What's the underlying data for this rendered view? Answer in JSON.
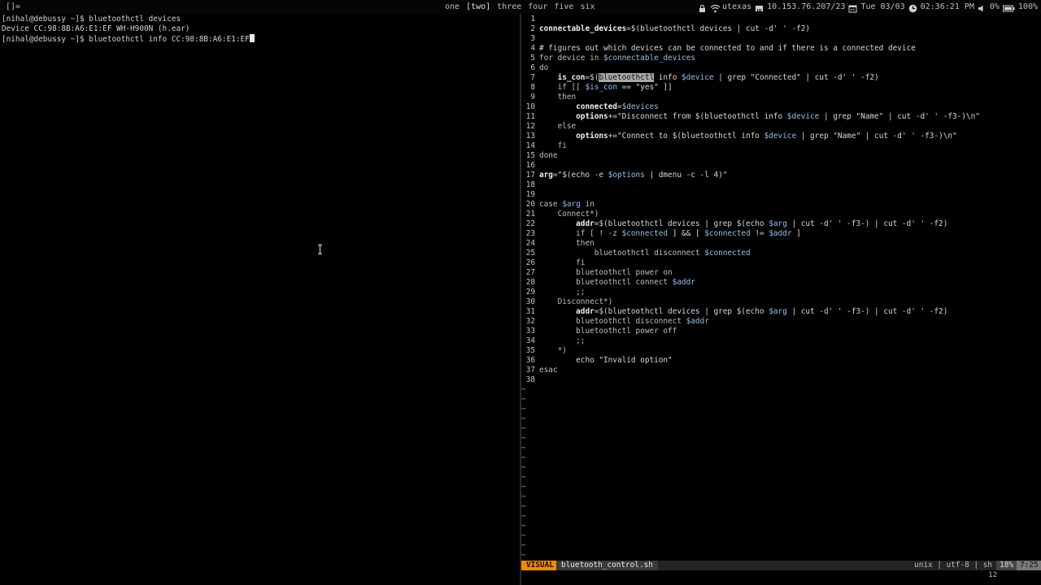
{
  "topbar": {
    "layout": "[]=",
    "workspaces": [
      {
        "label": "one",
        "active": false
      },
      {
        "label": "[two]",
        "active": true
      },
      {
        "label": "three",
        "active": false
      },
      {
        "label": "four",
        "active": false
      },
      {
        "label": "five",
        "active": false
      },
      {
        "label": "six",
        "active": false
      }
    ],
    "network_name": "utexas",
    "ip": "10.153.76.207/23",
    "date": "Tue 03/03",
    "time": "02:36:21 PM",
    "volume": "0%",
    "battery": "100%"
  },
  "terminal": {
    "lines": [
      "[nihal@debussy ~]$ bluetoothctl devices",
      "Device CC:98:8B:A6:E1:EF WH-H900N (h.ear)",
      "[nihal@debussy ~]$ bluetoothctl info CC:98:8B:A6:E1:EF"
    ]
  },
  "editor": {
    "lines": [
      {
        "n": "1",
        "segs": []
      },
      {
        "n": "2",
        "segs": [
          [
            "bold",
            "connectable_devices"
          ],
          [
            "",
            "=$(bluetoothctl devices | cut -d' ' -f2)"
          ]
        ]
      },
      {
        "n": "3",
        "segs": []
      },
      {
        "n": "4",
        "segs": [
          [
            "cmt",
            "# figures out which devices can be connected to and if there is a connected device"
          ]
        ]
      },
      {
        "n": "5",
        "segs": [
          [
            "kw",
            "for device in "
          ],
          [
            "var",
            "$connectable_devices"
          ]
        ]
      },
      {
        "n": "6",
        "segs": [
          [
            "kw",
            "do"
          ]
        ]
      },
      {
        "n": "7",
        "segs": [
          [
            "",
            "    "
          ],
          [
            "bold",
            "is_con"
          ],
          [
            "",
            "=$("
          ],
          [
            "sel",
            "bluetoothctl"
          ],
          [
            "",
            " info "
          ],
          [
            "var",
            "$device"
          ],
          [
            "",
            " | grep \"Connected\" | cut -d' ' -f2)"
          ]
        ]
      },
      {
        "n": "8",
        "segs": [
          [
            "",
            "    "
          ],
          [
            "kw",
            "if [[ "
          ],
          [
            "var",
            "$is_con"
          ],
          [
            "",
            " == \"yes\" ]]"
          ]
        ]
      },
      {
        "n": "9",
        "segs": [
          [
            "",
            "    "
          ],
          [
            "kw",
            "then"
          ]
        ]
      },
      {
        "n": "10",
        "segs": [
          [
            "",
            "        "
          ],
          [
            "bold",
            "connected"
          ],
          [
            "",
            "="
          ],
          [
            "var",
            "$devices"
          ]
        ]
      },
      {
        "n": "11",
        "segs": [
          [
            "",
            "        "
          ],
          [
            "bold",
            "options"
          ],
          [
            "",
            "+=\"Disconnect from $(bluetoothctl info "
          ],
          [
            "var",
            "$device"
          ],
          [
            "",
            " | grep \"Name\" | cut -d' ' -f3-)\\n\""
          ]
        ]
      },
      {
        "n": "12",
        "segs": [
          [
            "",
            "    "
          ],
          [
            "kw",
            "else"
          ]
        ]
      },
      {
        "n": "13",
        "segs": [
          [
            "",
            "        "
          ],
          [
            "bold",
            "options"
          ],
          [
            "",
            "+=\"Connect to $(bluetoothctl info "
          ],
          [
            "var",
            "$device"
          ],
          [
            "",
            " | grep \"Name\" | cut -d' ' -f3-)\\n\""
          ]
        ]
      },
      {
        "n": "14",
        "segs": [
          [
            "",
            "    "
          ],
          [
            "kw",
            "fi"
          ]
        ]
      },
      {
        "n": "15",
        "segs": [
          [
            "kw",
            "done"
          ]
        ]
      },
      {
        "n": "16",
        "segs": []
      },
      {
        "n": "17",
        "segs": [
          [
            "bold",
            "arg"
          ],
          [
            "",
            "=\"$(echo -e "
          ],
          [
            "var",
            "$options"
          ],
          [
            "",
            " | dmenu -c -l 4)\""
          ]
        ]
      },
      {
        "n": "18",
        "segs": []
      },
      {
        "n": "19",
        "segs": []
      },
      {
        "n": "20",
        "segs": [
          [
            "kw",
            "case "
          ],
          [
            "var",
            "$arg"
          ],
          [
            "kw",
            " in"
          ]
        ]
      },
      {
        "n": "21",
        "segs": [
          [
            "",
            "    "
          ],
          [
            "kw",
            "Connect*)"
          ]
        ]
      },
      {
        "n": "22",
        "segs": [
          [
            "",
            "        "
          ],
          [
            "bold",
            "addr"
          ],
          [
            "",
            "=$(bluetoothctl devices | grep $(echo "
          ],
          [
            "var",
            "$arg"
          ],
          [
            "",
            " | cut -d' ' -f3-) | cut -d' ' -f2)"
          ]
        ]
      },
      {
        "n": "23",
        "segs": [
          [
            "",
            "        "
          ],
          [
            "kw",
            "if [ ! -z "
          ],
          [
            "var",
            "$connected"
          ],
          [
            "",
            " ] && [ "
          ],
          [
            "var",
            "$connected"
          ],
          [
            "",
            " != "
          ],
          [
            "var",
            "$addr"
          ],
          [
            "",
            " ]"
          ]
        ]
      },
      {
        "n": "24",
        "segs": [
          [
            "",
            "        "
          ],
          [
            "kw",
            "then"
          ]
        ]
      },
      {
        "n": "25",
        "segs": [
          [
            "",
            "            "
          ],
          [
            "kw",
            "bluetoothctl disconnect "
          ],
          [
            "var",
            "$connected"
          ]
        ]
      },
      {
        "n": "26",
        "segs": [
          [
            "",
            "        "
          ],
          [
            "kw",
            "fi"
          ]
        ]
      },
      {
        "n": "27",
        "segs": [
          [
            "",
            "        "
          ],
          [
            "kw",
            "bluetoothctl power on"
          ]
        ]
      },
      {
        "n": "28",
        "segs": [
          [
            "",
            "        "
          ],
          [
            "kw",
            "bluetoothctl connect "
          ],
          [
            "var",
            "$addr"
          ]
        ]
      },
      {
        "n": "29",
        "segs": [
          [
            "",
            "        "
          ],
          [
            "kw",
            ";;"
          ]
        ]
      },
      {
        "n": "30",
        "segs": [
          [
            "",
            "    "
          ],
          [
            "kw",
            "Disconnect*)"
          ]
        ]
      },
      {
        "n": "31",
        "segs": [
          [
            "",
            "        "
          ],
          [
            "bold",
            "addr"
          ],
          [
            "",
            "=$(bluetoothctl devices | grep $(echo "
          ],
          [
            "var",
            "$arg"
          ],
          [
            "",
            " | cut -d' ' -f3-) | cut -d' ' -f2)"
          ]
        ]
      },
      {
        "n": "32",
        "segs": [
          [
            "",
            "        "
          ],
          [
            "kw",
            "bluetoothctl disconnect "
          ],
          [
            "var",
            "$addr"
          ]
        ]
      },
      {
        "n": "33",
        "segs": [
          [
            "",
            "        "
          ],
          [
            "kw",
            "bluetoothctl power off"
          ]
        ]
      },
      {
        "n": "34",
        "segs": [
          [
            "",
            "        "
          ],
          [
            "kw",
            ";;"
          ]
        ]
      },
      {
        "n": "35",
        "segs": [
          [
            "",
            "    "
          ],
          [
            "kw",
            "*)"
          ]
        ]
      },
      {
        "n": "36",
        "segs": [
          [
            "",
            "        echo \"Invalid option\""
          ]
        ]
      },
      {
        "n": "37",
        "segs": [
          [
            "kw",
            "esac"
          ]
        ]
      },
      {
        "n": "38",
        "segs": []
      }
    ],
    "tilde_count": 18,
    "tilde_char": "~"
  },
  "statusline": {
    "mode": "VISUAL",
    "filename": "bluetooth_control.sh",
    "fileinfo": "unix | utf-8 | sh",
    "percent": "18%",
    "position": "7:25",
    "selection_count": "12"
  },
  "colors": {
    "mode_bg": "#f08a00",
    "var": "#8fc0e8",
    "selection_bg": "#a8a8a8"
  }
}
